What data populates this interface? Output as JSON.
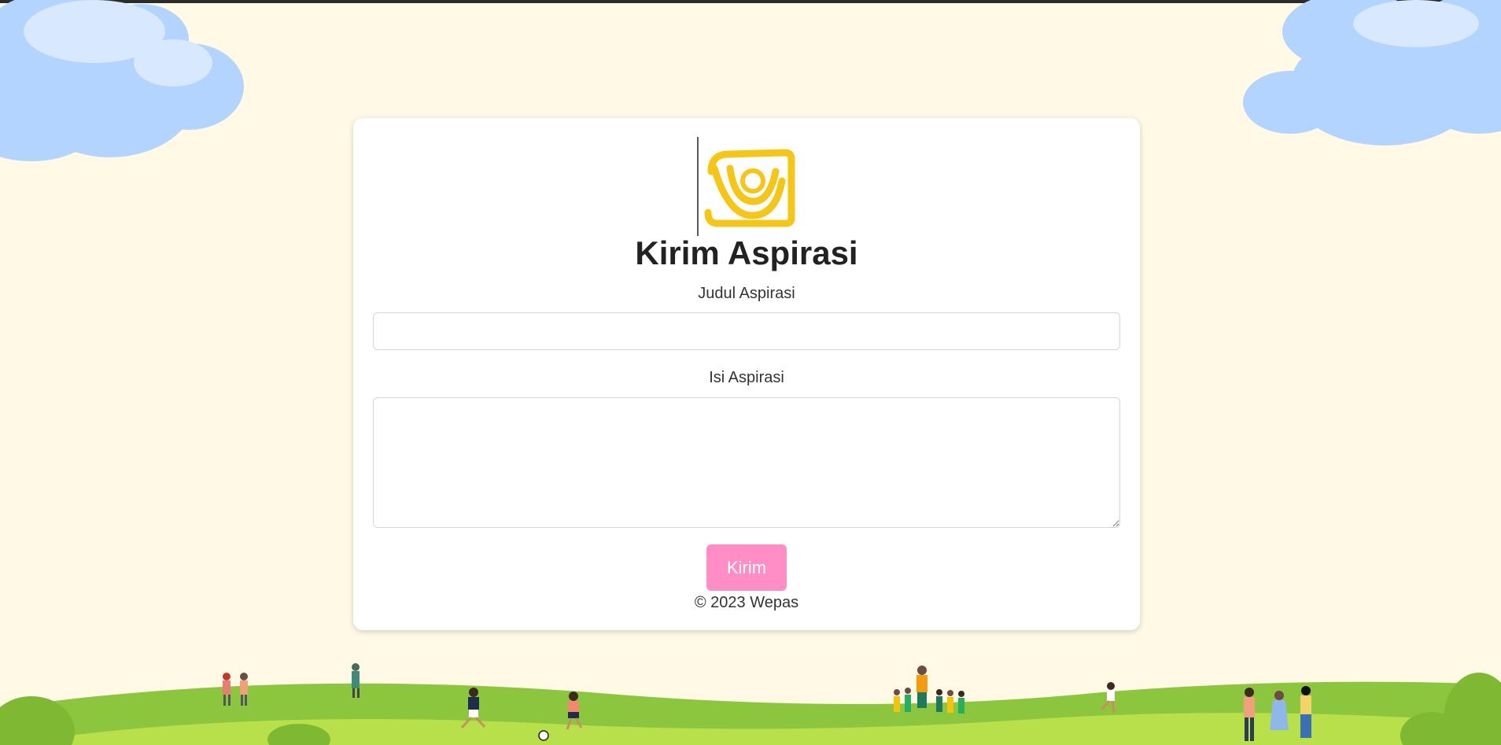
{
  "form": {
    "title": "Kirim Aspirasi",
    "judul_label": "Judul Aspirasi",
    "judul_value": "",
    "isi_label": "Isi Aspirasi",
    "isi_value": "",
    "submit_label": "Kirim",
    "footer": "© 2023 Wepas"
  },
  "icons": {
    "logo": "aspirasi-logo-icon"
  },
  "colors": {
    "background": "#fff9e6",
    "button": "#ff8ec7",
    "logo": "#f5c518",
    "cloud": "#b3d4ff",
    "hill_dark": "#8cc63f",
    "hill_light": "#b8e04a"
  }
}
